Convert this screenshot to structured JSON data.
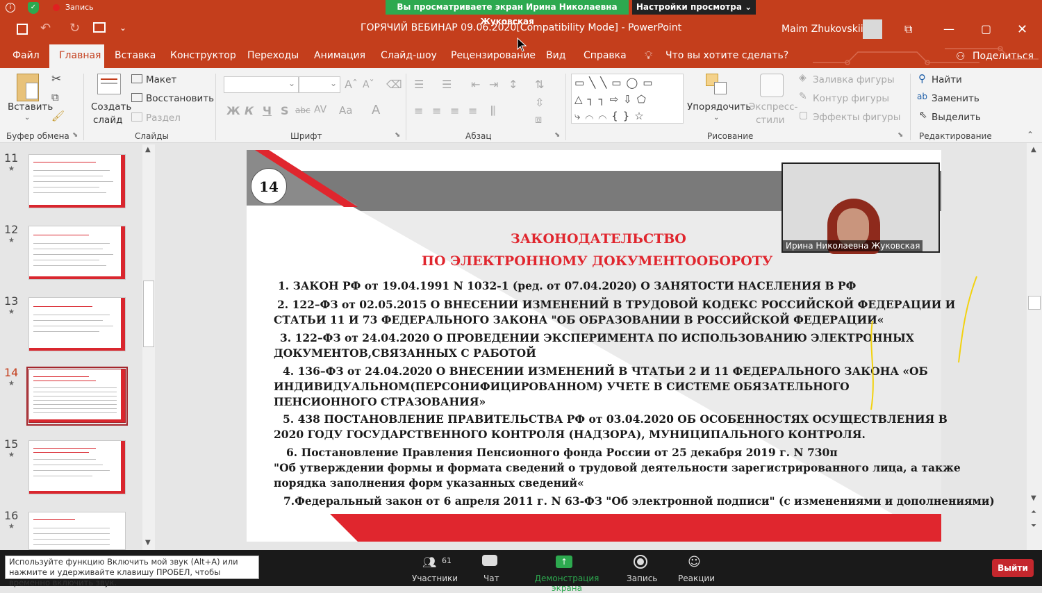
{
  "zoom_top": {
    "record_label": "Запись",
    "share_banner": "Вы просматриваете экран Ирина Николаевна Жуковская",
    "view_settings": "Настройки просмотра"
  },
  "window": {
    "title": "ГОРЯЧИЙ ВЕБИНАР 09.06.2020[Compatibility Mode]  -  PowerPoint",
    "user": "Maim Zhukovskii"
  },
  "menu": {
    "tabs": [
      "Файл",
      "Главная",
      "Вставка",
      "Конструктор",
      "Переходы",
      "Анимация",
      "Слайд-шоу",
      "Рецензирование",
      "Вид",
      "Справка"
    ],
    "tell_me": "Что вы хотите сделать?",
    "share": "Поделиться"
  },
  "ribbon": {
    "clipboard": {
      "paste": "Вставить",
      "label": "Буфер обмена"
    },
    "slides": {
      "new_slide_1": "Создать",
      "new_slide_2": "слайд",
      "layout": "Макет",
      "reset": "Восстановить",
      "section": "Раздел",
      "label": "Слайды"
    },
    "font": {
      "label": "Шрифт",
      "bold": "Ж",
      "italic": "К",
      "underline": "Ч",
      "shadow": "S",
      "strike": "abc",
      "spacing": "AV",
      "case": "Aa",
      "color": "A"
    },
    "paragraph": {
      "label": "Абзац"
    },
    "drawing": {
      "arrange": "Упорядочить",
      "quick_styles_1": "Экспресс-",
      "quick_styles_2": "стили",
      "fill": "Заливка фигуры",
      "outline": "Контур фигуры",
      "effects": "Эффекты фигуры",
      "label": "Рисование"
    },
    "editing": {
      "find": "Найти",
      "replace": "Заменить",
      "select": "Выделить",
      "label": "Редактирование"
    }
  },
  "thumbnails": [
    {
      "num": "11"
    },
    {
      "num": "12"
    },
    {
      "num": "13"
    },
    {
      "num": "14"
    },
    {
      "num": "15"
    },
    {
      "num": "16"
    }
  ],
  "slide": {
    "number": "14",
    "title_1": "ЗАКОНОДАТЕЛЬСТВО",
    "title_2": "ПО ЭЛЕКТРОННОМУ ДОКУМЕНТООБОРОТУ",
    "lines": [
      "1. ЗАКОН РФ от 19.04.1991 N 1032-1 (ред. от 07.04.2020) О ЗАНЯТОСТИ НАСЕЛЕНИЯ  В РФ",
      "2. 122–ФЗ  от  02.05.2015 О ВНЕСЕНИИ ИЗМЕНЕНИЙ В ТРУДОВОЙ КОДЕКС РОССИЙСКОЙ ФЕДЕРАЦИИ И",
      "СТАТЬИ 11 И 73 ФЕДЕРАЛЬНОГО ЗАКОНА \"ОБ ОБРАЗОВАНИИ В РОССИЙСКОЙ ФЕДЕРАЦИИ«",
      "3. 122–ФЗ от 24.04.2020 О ПРОВЕДЕНИИ ЭКСПЕРИМЕНТА ПО ИСПОЛЬЗОВАНИЮ ЭЛЕКТРОННЫХ",
      "ДОКУМЕНТОВ,СВЯЗАННЫХ С РАБОТОЙ",
      "4. 136–ФЗ от 24.04.2020 О ВНЕСЕНИИ ИЗМЕНЕНИЙ В ЧТАТЬИ 2 И 11 ФЕДЕРАЛЬНОГО ЗАКОНА «ОБ",
      "ИНДИВИДУАЛЬНОМ(ПЕРСОНИФИЦИРОВАННОМ) УЧЕТЕ В СИСТЕМЕ ОБЯЗАТЕЛЬНОГО",
      "ПЕНСИОННОГО СТРАЗОВАНИЯ»",
      "5. 438 ПОСТАНОВЛЕНИЕ ПРАВИТЕЛЬСТВА РФ от 03.04.2020 ОБ ОСОБЕННОСТЯХ ОСУЩЕСТВЛЕНИЯ В",
      "2020 ГОДУ ГОСУДАРСТВЕННОГО КОНТРОЛЯ (НАДЗОРА), МУНИЦИПАЛЬНОГО КОНТРОЛЯ.",
      "6. Постановление Правления Пенсионного фонда России от 25 декабря 2019 г. N 730п",
      "\"Об утверждении формы и формата сведений о трудовой деятельности зарегистрированного лица, а также",
      "порядка заполнения форм указанных сведений«",
      "7.Федеральный закон от 6 апреля 2011 г. N 63-ФЗ \"Об электронной подписи\" (с изменениями и дополнениями)"
    ]
  },
  "camera": {
    "name": "Ирина Николаевна Жуковская"
  },
  "zoom_bottom": {
    "participants": "Участники",
    "participants_count": "61",
    "chat": "Чат",
    "share_screen": "Демонстрация экрана",
    "record": "Запись",
    "reactions": "Реакции",
    "exit": "Выйти",
    "tooltip": "Используйте функцию Включить мой звук (Alt+A) или нажмите и удерживайте клавишу ПРОБЕЛ, чтобы временно включить звук."
  }
}
